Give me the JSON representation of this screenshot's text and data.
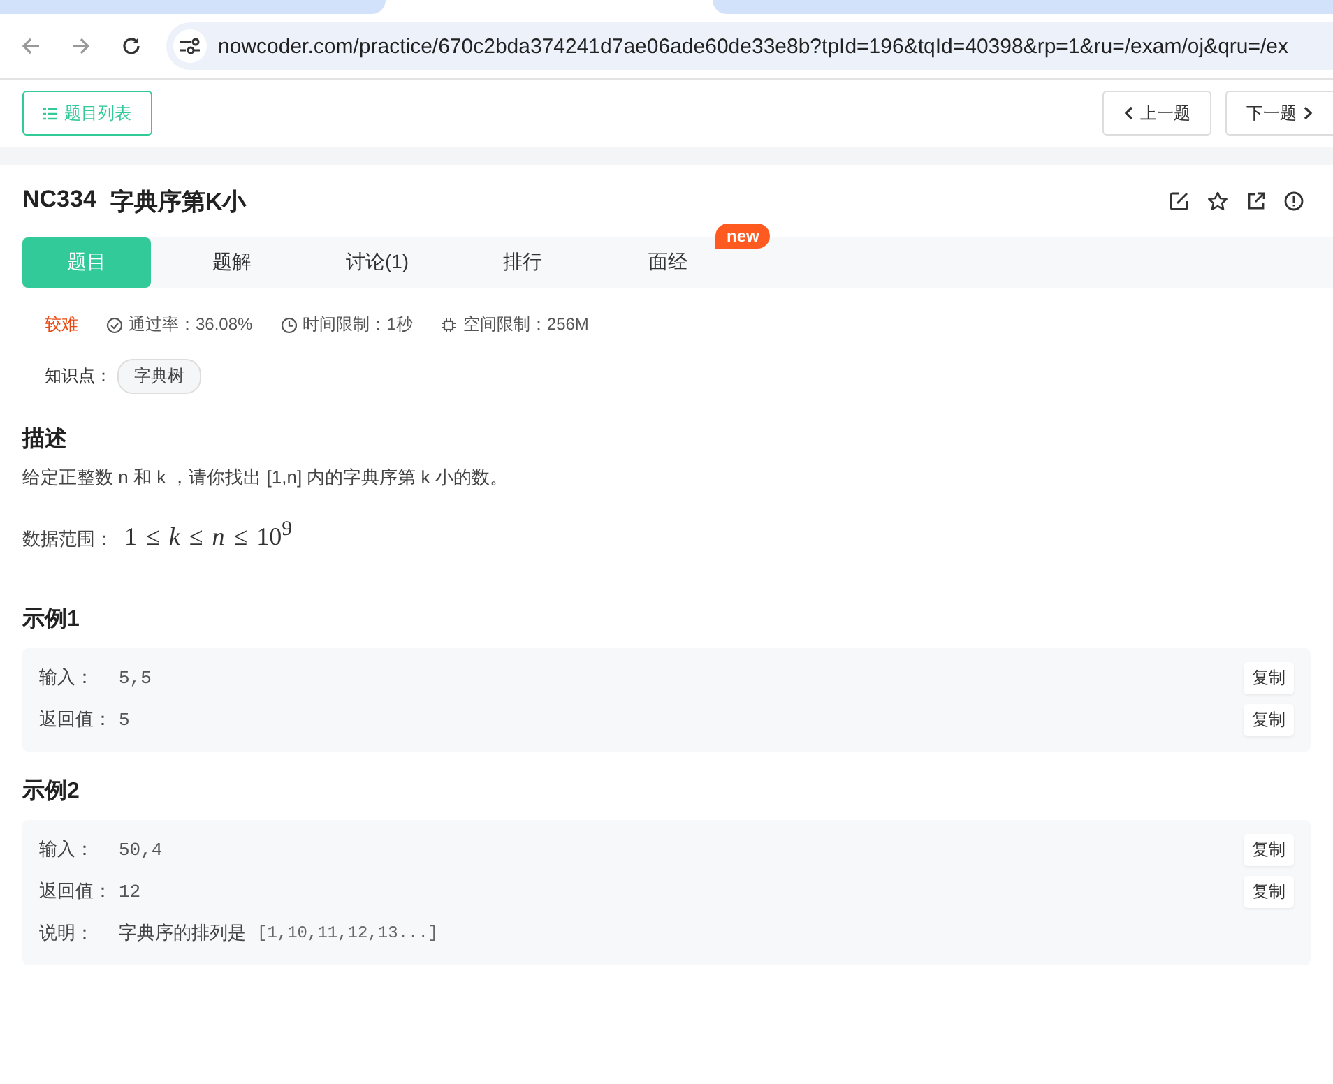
{
  "browser": {
    "url": "nowcoder.com/practice/670c2bda374241d7ae06ade60de33e8b?tpId=196&tqId=40398&rp=1&ru=/exam/oj&qru=/ex"
  },
  "toolbar": {
    "list_button": "题目列表",
    "prev_button": "上一题",
    "next_button": "下一题"
  },
  "problem": {
    "code": "NC334",
    "title": "字典序第K小"
  },
  "tabs": [
    {
      "label": "题目",
      "selected": true
    },
    {
      "label": "题解",
      "selected": false
    },
    {
      "label": "讨论(1)",
      "selected": false
    },
    {
      "label": "排行",
      "selected": false
    },
    {
      "label": "面经",
      "selected": false,
      "badge": "new"
    }
  ],
  "meta": {
    "difficulty": "较难",
    "pass_rate": "通过率：36.08%",
    "time_limit": "时间限制：1秒",
    "memory_limit": "空间限制：256M"
  },
  "knowledge": {
    "label": "知识点：",
    "tags": [
      "字典树"
    ]
  },
  "description": {
    "heading": "描述",
    "text": "给定正整数 n 和 k ，请你找出 [1,n] 内的字典序第 k 小的数。",
    "range_label": "数据范围：",
    "range_formula": "1 ≤ *k* ≤ *n* ≤ 10$^{9}$"
  },
  "examples": [
    {
      "heading": "示例1",
      "rows": [
        {
          "kind": "io",
          "label": "输入：",
          "value": "5,5",
          "copy": "复制"
        },
        {
          "kind": "io",
          "label": "返回值：",
          "value": "5",
          "copy": "复制"
        }
      ]
    },
    {
      "heading": "示例2",
      "rows": [
        {
          "kind": "io",
          "label": "输入：",
          "value": "50,4",
          "copy": "复制"
        },
        {
          "kind": "io",
          "label": "返回值：",
          "value": "12",
          "copy": "复制"
        },
        {
          "kind": "note",
          "label": "说明：",
          "value": "字典序的排列是",
          "code": "[1,10,11,12,13...]"
        }
      ]
    }
  ]
}
